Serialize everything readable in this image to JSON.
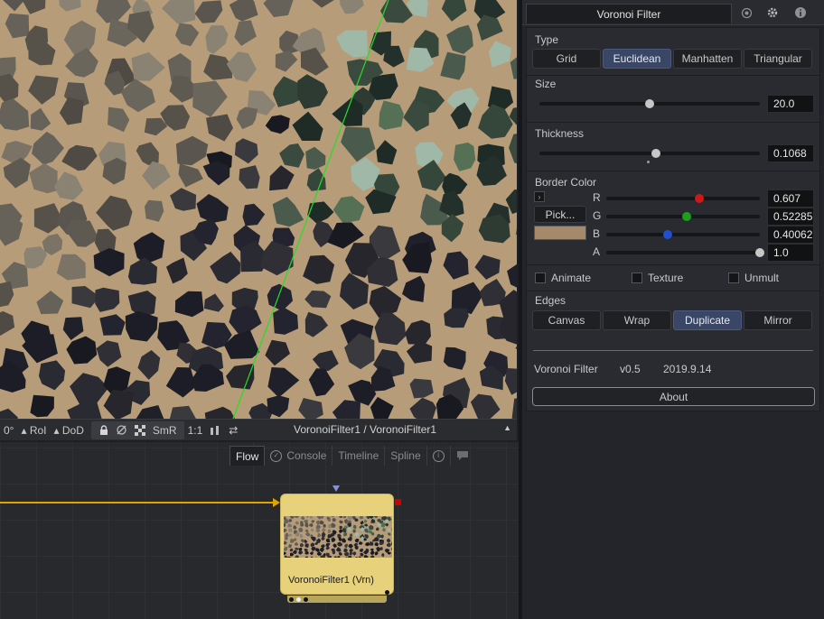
{
  "viewer": {
    "status_items": [
      "0°",
      "RoI",
      "DoD",
      "SmR",
      "1:1"
    ],
    "path": "VoronoiFilter1 / VoronoiFilter1"
  },
  "flow": {
    "tabs": [
      "Flow",
      "Console",
      "Timeline",
      "Spline"
    ],
    "active_tab": "Flow",
    "node_label": "VoronoiFilter1  (Vrn)",
    "connection_color": "#e0a400",
    "node_color": "#e7d17a"
  },
  "inspector": {
    "title": "Voronoi Filter",
    "type": {
      "label": "Type",
      "options": [
        "Grid",
        "Euclidean",
        "Manhatten",
        "Triangular"
      ],
      "selected": "Euclidean"
    },
    "size": {
      "label": "Size",
      "value": "20.0",
      "fraction": 0.5
    },
    "thickness": {
      "label": "Thickness",
      "value": "0.1068",
      "fraction": 0.53
    },
    "border_color": {
      "label": "Border Color",
      "pick_label": "Pick...",
      "swatch": "#a48a6b",
      "channels": [
        {
          "name": "R",
          "value": "0.607",
          "fraction": 0.607,
          "knob_color": "#d01818"
        },
        {
          "name": "G",
          "value": "0.52285",
          "fraction": 0.52285,
          "knob_color": "#1aa01a"
        },
        {
          "name": "B",
          "value": "0.40062",
          "fraction": 0.40062,
          "knob_color": "#2050d0"
        },
        {
          "name": "A",
          "value": "1.0",
          "fraction": 1.0,
          "knob_color": "#c7c7c7"
        }
      ]
    },
    "checkboxes": [
      {
        "label": "Animate",
        "checked": false
      },
      {
        "label": "Texture",
        "checked": false
      },
      {
        "label": "Unmult",
        "checked": false
      }
    ],
    "edges": {
      "label": "Edges",
      "options": [
        "Canvas",
        "Wrap",
        "Duplicate",
        "Mirror"
      ],
      "selected": "Duplicate"
    },
    "info": {
      "name": "Voronoi Filter",
      "version": "v0.5",
      "date": "2019.9.14"
    },
    "about_label": "About",
    "header_icons": [
      "settings-circle-icon",
      "gear-icon",
      "info-icon"
    ]
  }
}
